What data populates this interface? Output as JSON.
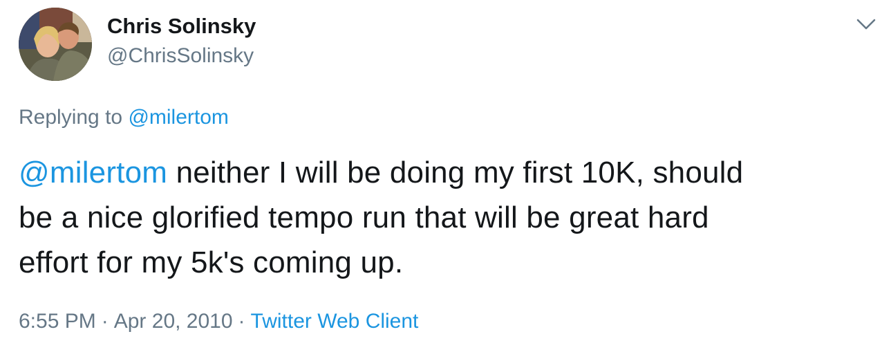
{
  "tweet": {
    "author": {
      "display_name": "Chris Solinsky",
      "handle": "@ChrisSolinsky",
      "avatar_icon": "profile-photo"
    },
    "menu_icon": "chevron-down-icon",
    "reply": {
      "prefix": "Replying to",
      "mention": "@milertom"
    },
    "body": {
      "mention": "@milertom",
      "line1_rest": " neither I will be doing my first 10K, should",
      "line2": "be a nice glorified tempo run that will be great hard",
      "line3": "effort for my 5k's coming up."
    },
    "meta": {
      "time": "6:55 PM",
      "separator": "·",
      "date": "Apr 20, 2010",
      "source": "Twitter Web Client"
    }
  },
  "colors": {
    "text": "#14171a",
    "secondary": "#657786",
    "link": "#1b95e0",
    "background": "#ffffff"
  }
}
